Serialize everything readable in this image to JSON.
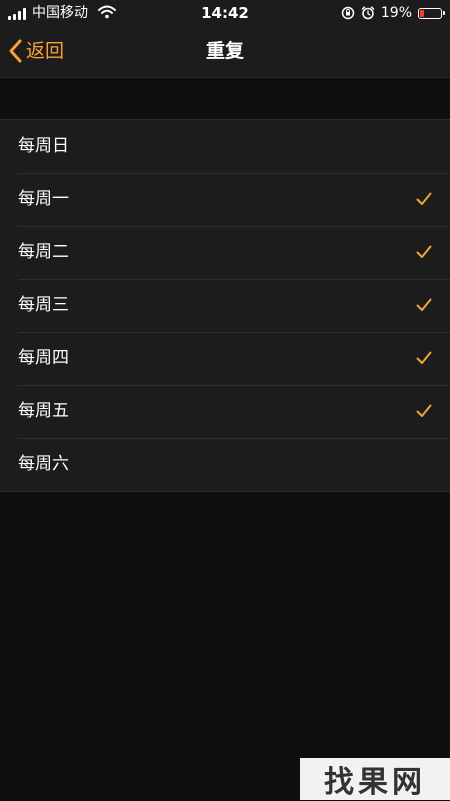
{
  "status_bar": {
    "carrier": "中国移动",
    "time": "14:42",
    "battery_percent": "19%",
    "battery_level": 0.19,
    "icons": [
      "signal-icon",
      "wifi-icon",
      "orientation-lock-icon",
      "alarm-icon",
      "battery-icon"
    ]
  },
  "nav": {
    "back_label": "返回",
    "title": "重复"
  },
  "repeat_days": [
    {
      "label": "每周日",
      "checked": false
    },
    {
      "label": "每周一",
      "checked": true
    },
    {
      "label": "每周二",
      "checked": true
    },
    {
      "label": "每周三",
      "checked": true
    },
    {
      "label": "每周四",
      "checked": true
    },
    {
      "label": "每周五",
      "checked": true
    },
    {
      "label": "每周六",
      "checked": false
    }
  ],
  "colors": {
    "accent": "#f7a137",
    "background": "#0f0f0f",
    "cell": "#1c1c1c",
    "battery_low": "#ff3b30"
  },
  "watermark": "找果网"
}
